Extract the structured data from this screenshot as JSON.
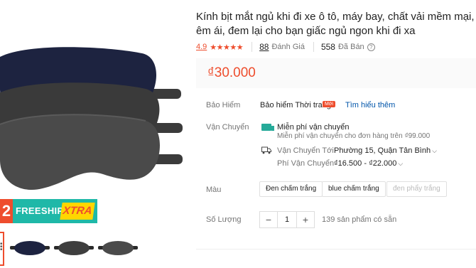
{
  "product": {
    "title": "Kính bịt mắt ngủ khi đi xe ô tô, máy bay, chất vải mềm mại, êm ái, đem lại cho bạn giấc ngủ ngon khi đi xa",
    "rating": "4.9",
    "stars": "★★★★★",
    "review_count": "88",
    "review_label": "Đánh Giá",
    "sold_count": "558",
    "sold_label": "Đã Bán",
    "price": "₫30.000"
  },
  "badge": {
    "leading_num": "2",
    "freeship": "FREESHIP",
    "xtra": "XTRA"
  },
  "insurance": {
    "label": "Bảo Hiểm",
    "value": "Bảo hiểm Thời trang",
    "new_badge": "Mới",
    "learn_more": "Tìm hiểu thêm"
  },
  "shipping": {
    "label": "Vận Chuyển",
    "free_title": "Miễn phí vận chuyển",
    "free_sub": "Miễn phí vận chuyển cho đơn hàng trên ₫99.000",
    "ship_to_label": "Vận Chuyển Tới",
    "ship_to_value": "Phường 15, Quận Tân Bình",
    "fee_label": "Phí Vận Chuyển",
    "fee_value": "₫16.500 - ₫22.000"
  },
  "color": {
    "label": "Màu",
    "options": [
      "Đen chấm trắng",
      "blue chấm trắng",
      "đen phẩy trắng"
    ]
  },
  "quantity": {
    "label": "Số Lượng",
    "minus": "−",
    "value": "1",
    "plus": "+",
    "stock": "139 sản phẩm có sẵn"
  },
  "colors": {
    "accent": "#ee4d2d",
    "teal": "#26aa99",
    "link": "#0055aa"
  }
}
